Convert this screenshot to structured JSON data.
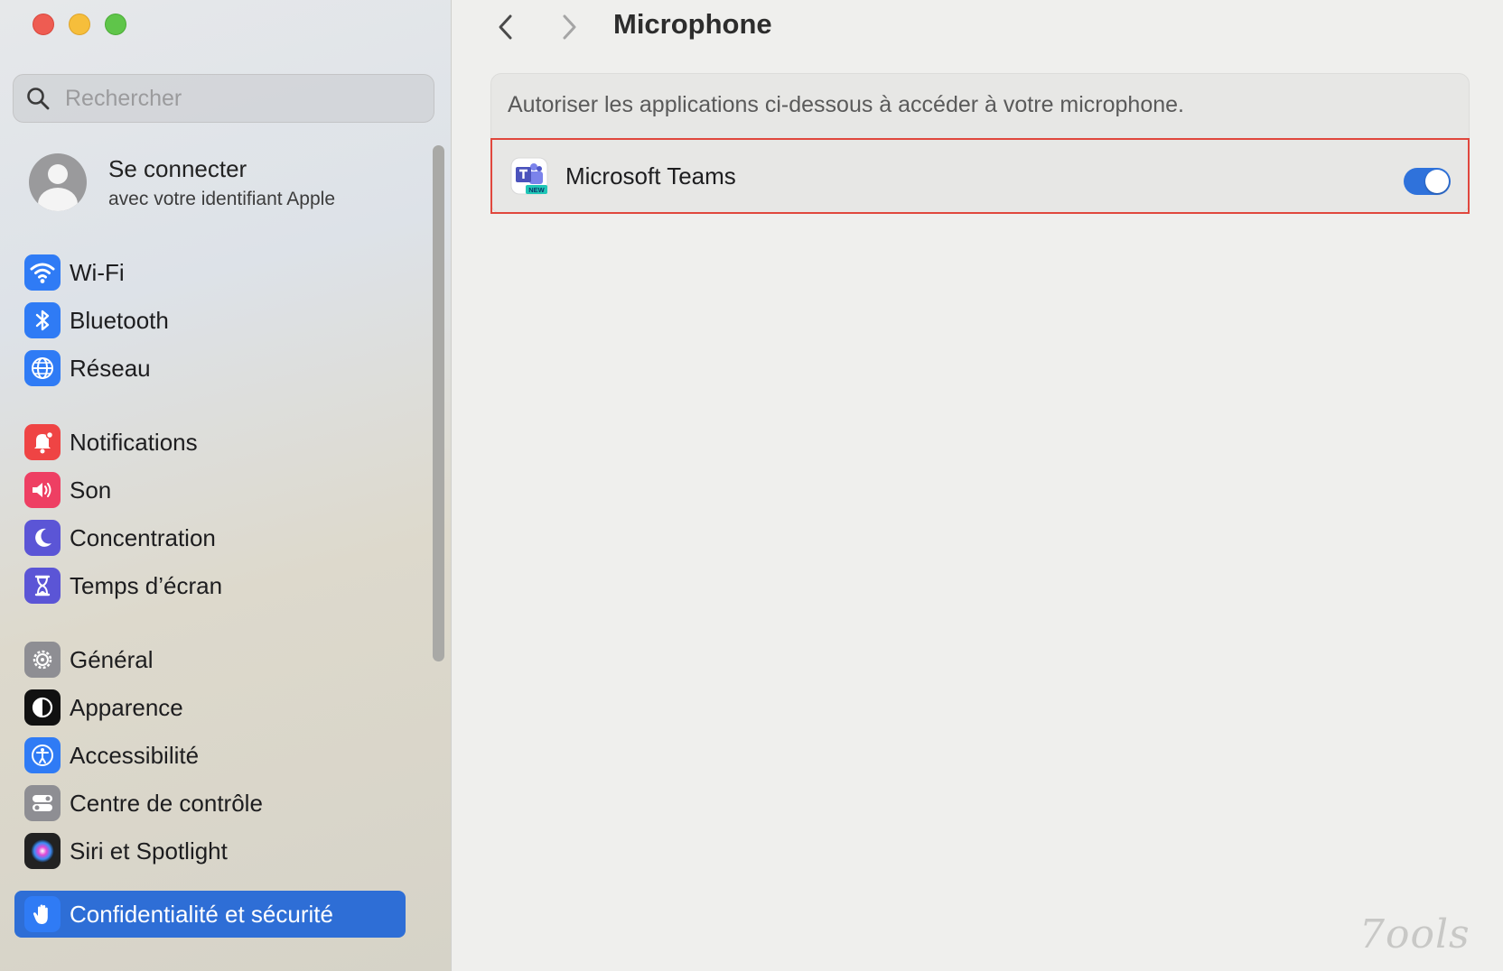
{
  "window": {
    "traffic_lights": [
      "close",
      "minimize",
      "zoom"
    ]
  },
  "search": {
    "placeholder": "Rechercher"
  },
  "account": {
    "title": "Se connecter",
    "subtitle": "avec votre identifiant Apple"
  },
  "sidebar": {
    "items": [
      {
        "label": "Wi-Fi",
        "icon": "wifi-icon",
        "color": "#2f7bf5"
      },
      {
        "label": "Bluetooth",
        "icon": "bluetooth-icon",
        "color": "#2f7bf5"
      },
      {
        "label": "Réseau",
        "icon": "globe-icon",
        "color": "#2f7bf5"
      },
      {
        "label": "Notifications",
        "icon": "bell-icon",
        "color": "#ef4444"
      },
      {
        "label": "Son",
        "icon": "speaker-icon",
        "color": "#ee3f63"
      },
      {
        "label": "Concentration",
        "icon": "moon-icon",
        "color": "#5b55d6"
      },
      {
        "label": "Temps d’écran",
        "icon": "hourglass-icon",
        "color": "#5b55d6"
      },
      {
        "label": "Général",
        "icon": "gear-icon",
        "color": "#8e8e93"
      },
      {
        "label": "Apparence",
        "icon": "appearance-icon",
        "color": "#111111"
      },
      {
        "label": "Accessibilité",
        "icon": "accessibility-icon",
        "color": "#2f7bf5"
      },
      {
        "label": "Centre de contrôle",
        "icon": "control-center-icon",
        "color": "#8e8e93"
      },
      {
        "label": "Siri et Spotlight",
        "icon": "siri-icon",
        "color": "#222222"
      },
      {
        "label": "Confidentialité et sécurité",
        "icon": "hand-icon",
        "color": "#2f7bf5",
        "selected": true
      }
    ]
  },
  "header": {
    "title": "Microphone"
  },
  "content": {
    "description": "Autoriser les applications ci-dessous à accéder à votre microphone.",
    "apps": [
      {
        "name": "Microsoft Teams",
        "badge": "NEW",
        "enabled": true
      }
    ]
  },
  "watermark": "7ools",
  "colors": {
    "accent": "#2f72db",
    "highlight_border": "#e0473d",
    "selected_bg": "#2e6ed6"
  }
}
